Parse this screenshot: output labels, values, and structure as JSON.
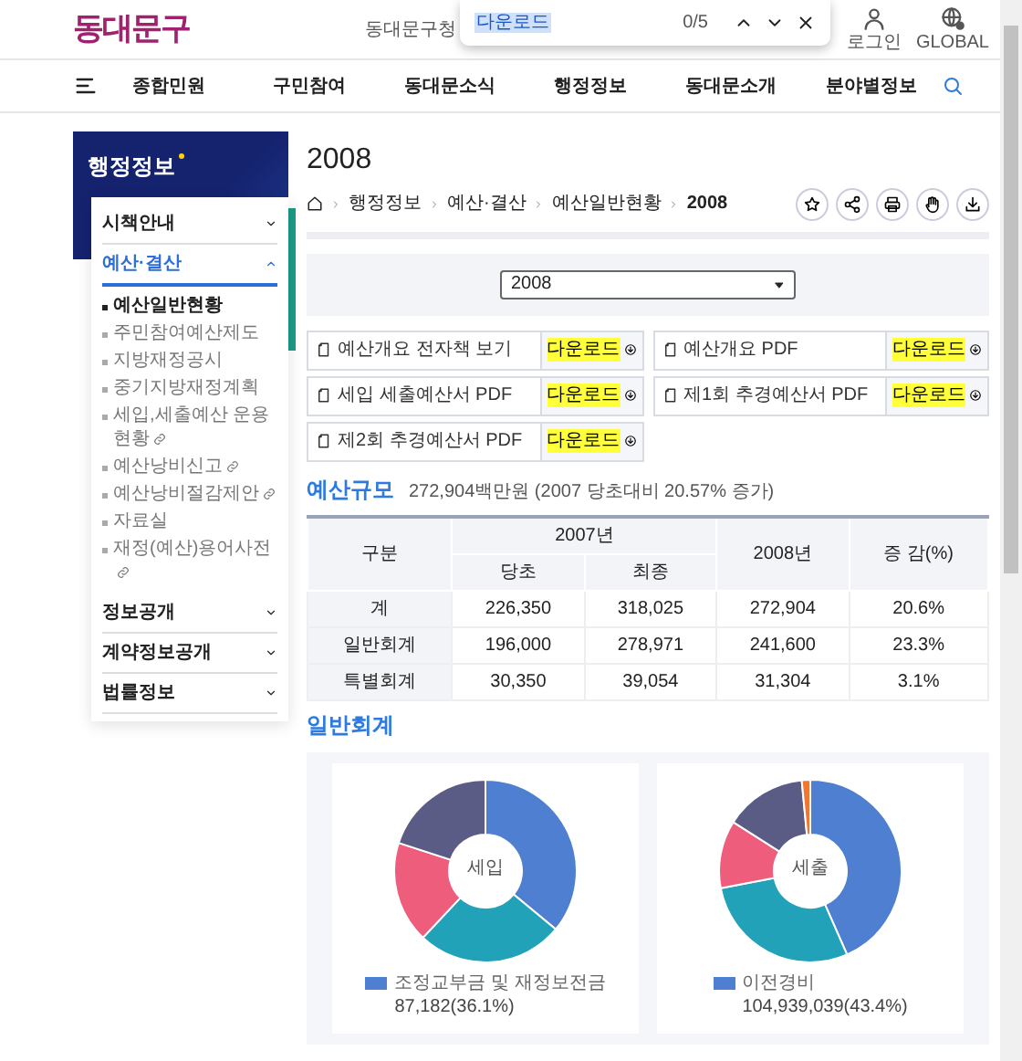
{
  "header": {
    "logo": "동대문구",
    "site_link": "동대문구청",
    "utilities": [
      {
        "label": "로그인",
        "kind": "login"
      },
      {
        "label": "GLOBAL",
        "kind": "global"
      }
    ]
  },
  "find_bar": {
    "query": "다운로드",
    "count": "0/5"
  },
  "nav": {
    "items": [
      "종합민원",
      "구민참여",
      "동대문소식",
      "행정정보",
      "동대문소개",
      "분야별정보"
    ]
  },
  "sidebar": {
    "title": "행정정보",
    "items": [
      {
        "label": "시책안내",
        "expanded": false
      },
      {
        "label": "예산·결산",
        "expanded": true,
        "children": [
          {
            "label": "예산일반현황",
            "selected": true,
            "external": false
          },
          {
            "label": "주민참여예산제도",
            "selected": false,
            "external": false
          },
          {
            "label": "지방재정공시",
            "selected": false,
            "external": false
          },
          {
            "label": "중기지방재정계획",
            "selected": false,
            "external": false
          },
          {
            "label": "세입,세출예산 운용현황",
            "selected": false,
            "external": true
          },
          {
            "label": "예산낭비신고",
            "selected": false,
            "external": true
          },
          {
            "label": "예산낭비절감제안",
            "selected": false,
            "external": true
          },
          {
            "label": "자료실",
            "selected": false,
            "external": false
          },
          {
            "label": "재정(예산)용어사전",
            "selected": false,
            "external": true
          }
        ]
      },
      {
        "label": "정보공개",
        "expanded": false
      },
      {
        "label": "계약정보공개",
        "expanded": false
      },
      {
        "label": "법률정보",
        "expanded": false
      }
    ]
  },
  "page": {
    "title": "2008",
    "breadcrumb": [
      "행정정보",
      "예산·결산",
      "예산일반현황",
      "2008"
    ]
  },
  "year_select": {
    "value": "2008"
  },
  "downloads": [
    {
      "label": "예산개요 전자책 보기",
      "action": "다운로드",
      "highlighted": true
    },
    {
      "label": "예산개요 PDF",
      "action": "다운로드",
      "highlighted": true
    },
    {
      "label": "세입 세출예산서 PDF",
      "action": "다운로드",
      "highlighted": true
    },
    {
      "label": "제1회 추경예산서 PDF",
      "action": "다운로드",
      "highlighted": true
    },
    {
      "label": "제2회 추경예산서 PDF",
      "action": "다운로드",
      "highlighted": true
    }
  ],
  "budget": {
    "heading": "예산규모",
    "summary": "272,904백만원 (2007 당초대비 20.57% 증가)",
    "table": {
      "header_top": [
        "구분",
        "2007년",
        "2008년",
        "증 감(%)"
      ],
      "header_sub": [
        "당초",
        "최종"
      ],
      "rows": [
        [
          "계",
          "226,350",
          "318,025",
          "272,904",
          "20.6%"
        ],
        [
          "일반회계",
          "196,000",
          "278,971",
          "241,600",
          "23.3%"
        ],
        [
          "특별회계",
          "30,350",
          "39,054",
          "31,304",
          "3.1%"
        ]
      ]
    }
  },
  "general_account": {
    "heading": "일반회계",
    "charts": [
      {
        "center": "세입",
        "legend": [
          {
            "label": "조정교부금 및 재정보전금",
            "value": "87,182(36.1%)",
            "color": "#4f7fd0"
          }
        ]
      },
      {
        "center": "세출",
        "legend": [
          {
            "label": "이전경비",
            "value": "104,939,039(43.4%)",
            "color": "#4f7fd0"
          }
        ]
      }
    ]
  }
}
